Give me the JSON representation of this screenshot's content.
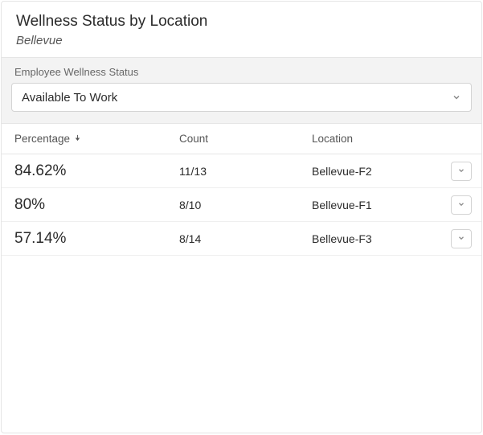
{
  "header": {
    "title": "Wellness Status by Location",
    "subtitle": "Bellevue"
  },
  "filter": {
    "label": "Employee Wellness Status",
    "selected": "Available To Work"
  },
  "columns": {
    "percentage": "Percentage",
    "count": "Count",
    "location": "Location"
  },
  "rows": [
    {
      "percentage": "84.62%",
      "count": "11/13",
      "location": "Bellevue-F2"
    },
    {
      "percentage": "80%",
      "count": "8/10",
      "location": "Bellevue-F1"
    },
    {
      "percentage": "57.14%",
      "count": "8/14",
      "location": "Bellevue-F3"
    }
  ]
}
